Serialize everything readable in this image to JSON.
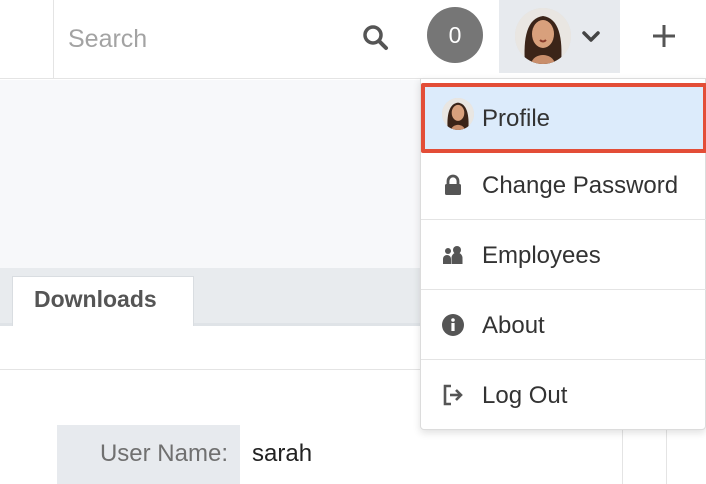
{
  "search": {
    "placeholder": "Search"
  },
  "notifications": {
    "count": "0"
  },
  "user_menu": {
    "items": [
      {
        "label": "Profile",
        "icon": "avatar"
      },
      {
        "label": "Change Password",
        "icon": "lock-icon"
      },
      {
        "label": "Employees",
        "icon": "people-icon"
      },
      {
        "label": "About",
        "icon": "info-icon"
      },
      {
        "label": "Log Out",
        "icon": "logout-icon"
      }
    ]
  },
  "tabs": [
    {
      "label": "Downloads"
    }
  ],
  "form": {
    "user_name_label": "User Name:",
    "user_name_value": "sarah"
  },
  "colors": {
    "highlight_border": "#e34d37",
    "highlight_bg": "#dcebfb",
    "badge": "#767676"
  }
}
